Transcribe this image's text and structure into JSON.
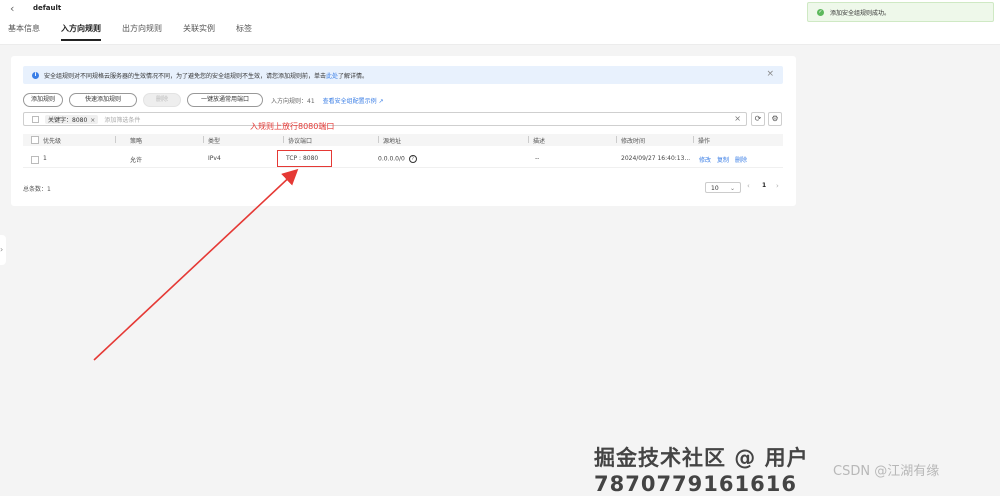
{
  "header": {
    "back_icon": "chevron-left-icon",
    "title": "default",
    "tabs": [
      {
        "label": "基本信息"
      },
      {
        "label": "入方向规则",
        "active": true
      },
      {
        "label": "出方向规则"
      },
      {
        "label": "关联实例"
      },
      {
        "label": "标签"
      }
    ]
  },
  "toast": {
    "text": "添加安全组规则成功。",
    "icon": "check-circle-icon"
  },
  "info_banner": {
    "text_before": "安全组规则对不同规格云服务器的生效情况不同，为了避免您的安全组规则不生效，请您添加规则前，单击",
    "link": "此处",
    "text_after": "了解详情。",
    "icon": "info-icon",
    "close_icon": "close-icon"
  },
  "toolbar": {
    "add_rule": "添加规则",
    "quick_add_rule": "快速添加规则",
    "delete": "删除",
    "allow_common_ports": "一键放通常用端口",
    "rule_count": "入方向规则：41",
    "view_example": "查看安全组配置示例"
  },
  "filter": {
    "tag_label": "关键字：8080",
    "placeholder": "添加筛选条件",
    "refresh_icon": "refresh-icon",
    "settings_icon": "gear-icon"
  },
  "table": {
    "columns": [
      "优先级",
      "策略",
      "类型",
      "协议端口",
      "源地址",
      "描述",
      "修改时间",
      "操作"
    ],
    "rows": [
      {
        "priority": "1",
        "policy": "允许",
        "type": "IPv4",
        "protocol_port": "TCP : 8080",
        "source": "0.0.0.0/0",
        "description": "--",
        "modified": "2024/09/27 16:40:13...",
        "actions": [
          "修改",
          "复制",
          "删除"
        ]
      }
    ]
  },
  "footer": {
    "total": "总条数：1",
    "page_size": "10",
    "current_page": "1"
  },
  "annotation": {
    "text": "入规则上放行8080端口"
  },
  "watermark": {
    "main": "掘金技术社区 @ 用户7870779161616",
    "secondary": "CSDN @江湖有缘"
  },
  "colors": {
    "accent": "#3a7ee6",
    "annotation": "#e53935",
    "success": "#5cb85c"
  }
}
